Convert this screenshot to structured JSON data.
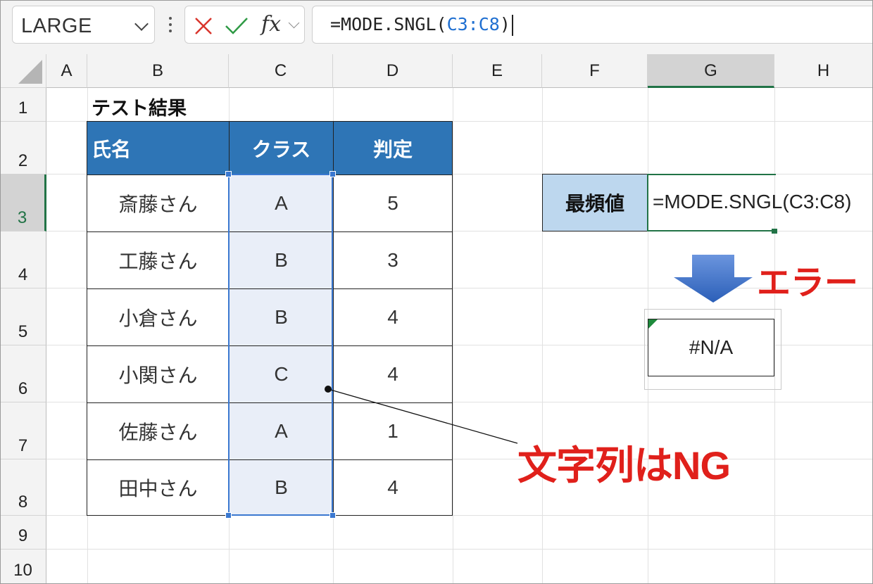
{
  "name_box": "LARGE",
  "formula_bar": {
    "prefix": "=MODE.SNGL(",
    "ref": "C3:C8",
    "suffix": ")"
  },
  "columns": [
    "A",
    "B",
    "C",
    "D",
    "E",
    "F",
    "G",
    "H"
  ],
  "rows": [
    "1",
    "2",
    "3",
    "4",
    "5",
    "6",
    "7",
    "8",
    "9",
    "10"
  ],
  "sheet": {
    "title": "テスト結果",
    "headers": [
      "氏名",
      "クラス",
      "判定"
    ],
    "records": [
      {
        "name": "斎藤さん",
        "class": "A",
        "score": "5"
      },
      {
        "name": "工藤さん",
        "class": "B",
        "score": "3"
      },
      {
        "name": "小倉さん",
        "class": "B",
        "score": "4"
      },
      {
        "name": "小関さん",
        "class": "C",
        "score": "4"
      },
      {
        "name": "佐藤さん",
        "class": "A",
        "score": "1"
      },
      {
        "name": "田中さん",
        "class": "B",
        "score": "4"
      }
    ],
    "mode_label": "最頻値",
    "mode_formula": "=MODE.SNGL(C3:C8)",
    "error_result": "#N/A"
  },
  "annotations": {
    "error": "エラー",
    "note": "文字列はNG"
  },
  "colors": {
    "header_fill": "#2e75b6",
    "label_fill": "#bdd7ee",
    "selection": "#3a78d0",
    "annotation": "#e0201b",
    "arrow": "#3b6fc4"
  },
  "icons": [
    "cancel-icon",
    "enter-icon",
    "fx-icon",
    "chevron-down-icon",
    "more-icon"
  ]
}
